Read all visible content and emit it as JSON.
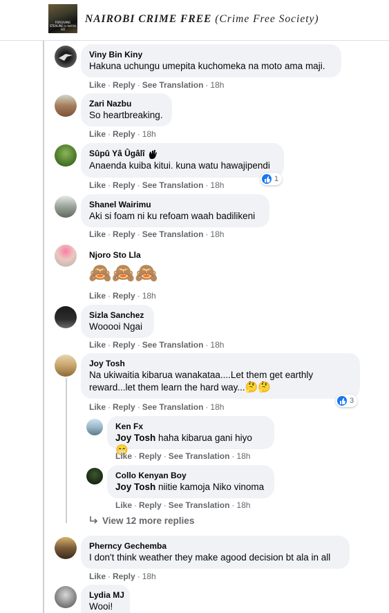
{
  "group": {
    "title_main": "NAIROBI CRIME FREE",
    "title_sub": "(Crime Free Society)",
    "avatar_caption": "FORGIVING STEALING is hell to GO"
  },
  "comments": [
    {
      "name": "Viny Bin Kiny",
      "text": "Hakuna uchungu umepita kuchomeka na moto ama maji.",
      "like": "Like",
      "reply": "Reply",
      "translate": "See Translation",
      "time": "18h"
    },
    {
      "name": "Zari Nazbu",
      "text": "So heartbreaking.",
      "like": "Like",
      "reply": "Reply",
      "time": "18h"
    },
    {
      "name": "Sûpû Yâ Ûgâlî",
      "text": "Anaenda kuiba kitui. kuna watu hawajipendi",
      "like": "Like",
      "reply": "Reply",
      "translate": "See Translation",
      "time": "18h",
      "reactions": "1"
    },
    {
      "name": "Shanel Wairimu",
      "text": "Aki si foam ni ku refoam waah badilikeni",
      "like": "Like",
      "reply": "Reply",
      "translate": "See Translation",
      "time": "18h"
    },
    {
      "name": "Njoro Sto Lla",
      "text": "🙈🙈🙈",
      "like": "Like",
      "reply": "Reply",
      "time": "18h"
    },
    {
      "name": "Sizla Sanchez",
      "text": "Wooooi Ngai",
      "like": "Like",
      "reply": "Reply",
      "translate": "See Translation",
      "time": "18h"
    },
    {
      "name": "Joy Tosh",
      "text_line1": "Na ukiwaitia kibarua wanakataa....Let them get earthly",
      "text_line2": "reward...let them learn the hard way...",
      "emoji": "🤔🤔",
      "like": "Like",
      "reply": "Reply",
      "translate": "See Translation",
      "time": "18h",
      "reactions": "3"
    },
    {
      "name": "Ken Fx",
      "mention": "Joy Tosh",
      "text": "haha kibarua gani hiyo",
      "emoji": "😁",
      "like": "Like",
      "reply": "Reply",
      "translate": "See Translation",
      "time": "18h"
    },
    {
      "name": "Collo Kenyan Boy",
      "mention": "Joy Tosh",
      "text": "niitie kamoja Niko vinoma",
      "like": "Like",
      "reply": "Reply",
      "translate": "See Translation",
      "time": "18h"
    },
    {
      "name": "Pherncy Gechemba",
      "text": "I don't think weather they make agood decision bt ala in all",
      "like": "Like",
      "reply": "Reply",
      "time": "18h"
    },
    {
      "name": "Lydia MJ",
      "text": "Wooi!"
    }
  ],
  "view_more": "View 12 more replies",
  "colors": {
    "accent": "#1877f2",
    "bubble": "#f0f2f5",
    "meta": "#65676b",
    "line": "#ccd0d5"
  }
}
